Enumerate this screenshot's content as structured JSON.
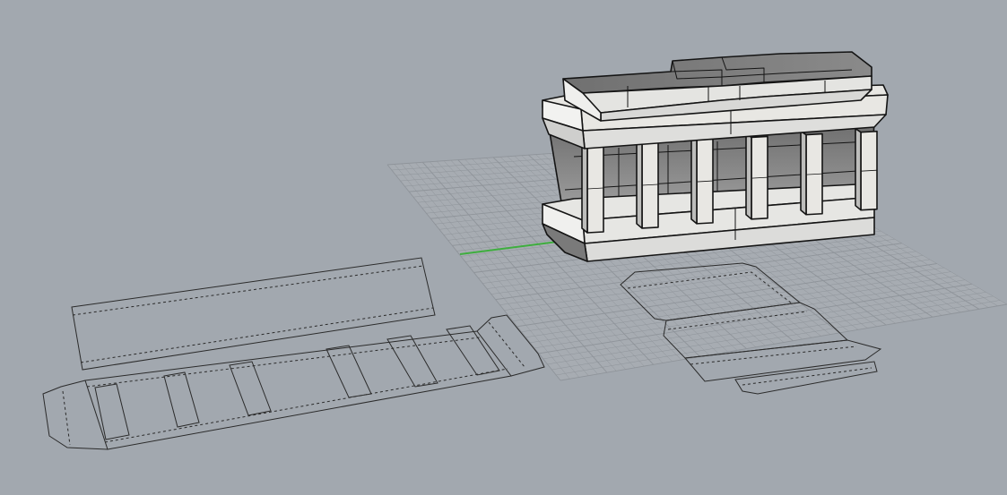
{
  "viewport": {
    "name": "Perspective",
    "background_color": "#a2a8af",
    "grid_color": "#8f949a",
    "grid_visible": true,
    "axis_x_color": "#b03a3a",
    "axis_y_color": "#3fae3f"
  },
  "scene": {
    "solid_object": {
      "kind": "colonnade-box-model",
      "face_light_color": "#e8e7e3",
      "face_dark_color": "#7c7c7c",
      "edge_color": "#141414",
      "column_count": 6
    },
    "unfolded_patterns": [
      {
        "kind": "long-box-net",
        "cutout_count": 6,
        "line_style": "dashed"
      },
      {
        "kind": "lid-box-net",
        "line_style": "dashed"
      }
    ]
  }
}
